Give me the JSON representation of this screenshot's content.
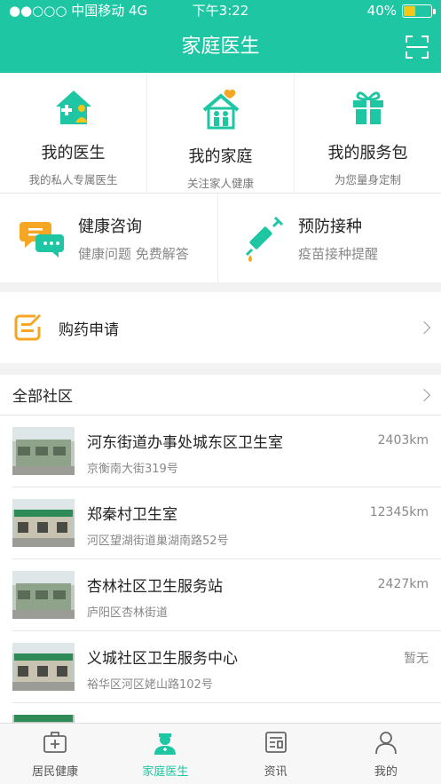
{
  "status": {
    "carrier": "●●○○○ 中国移动  4G",
    "time": "下午3:22",
    "battery": "40%",
    "battery_level": 0.4
  },
  "nav": {
    "title": "家庭医生"
  },
  "features": [
    {
      "title": "我的医生",
      "subtitle": "我的私人专属医生",
      "icon": "doctor-house-icon"
    },
    {
      "title": "我的家庭",
      "subtitle": "关注家人健康",
      "icon": "family-house-icon"
    },
    {
      "title": "我的服务包",
      "subtitle": "为您量身定制",
      "icon": "gift-icon"
    }
  ],
  "services": [
    {
      "title": "健康咨询",
      "subtitle": "健康问题  免费解答",
      "icon": "chat-icon"
    },
    {
      "title": "预防接种",
      "subtitle": "疫苗接种提醒",
      "icon": "syringe-icon"
    }
  ],
  "buy": {
    "label": "购药申请"
  },
  "community": {
    "header": "全部社区",
    "items": [
      {
        "name": "河东街道办事处城东区卫生室",
        "address": "京衡南大街319号",
        "distance": "2403km"
      },
      {
        "name": "郑秦村卫生室",
        "address": "河区望湖街道巢湖南路52号",
        "distance": "12345km"
      },
      {
        "name": "杏林社区卫生服务站",
        "address": "庐阳区杏林街道",
        "distance": "2427km"
      },
      {
        "name": "义城社区卫生服务中心",
        "address": "裕华区河区姥山路102号",
        "distance": "暂无"
      }
    ]
  },
  "tabs": [
    {
      "label": "居民健康",
      "icon": "medical-kit-icon"
    },
    {
      "label": "家庭医生",
      "icon": "doctor-icon",
      "active": true
    },
    {
      "label": "资讯",
      "icon": "news-icon"
    },
    {
      "label": "我的",
      "icon": "user-icon"
    }
  ],
  "colors": {
    "primary": "#1ec6a4",
    "accent": "#f5a623"
  }
}
